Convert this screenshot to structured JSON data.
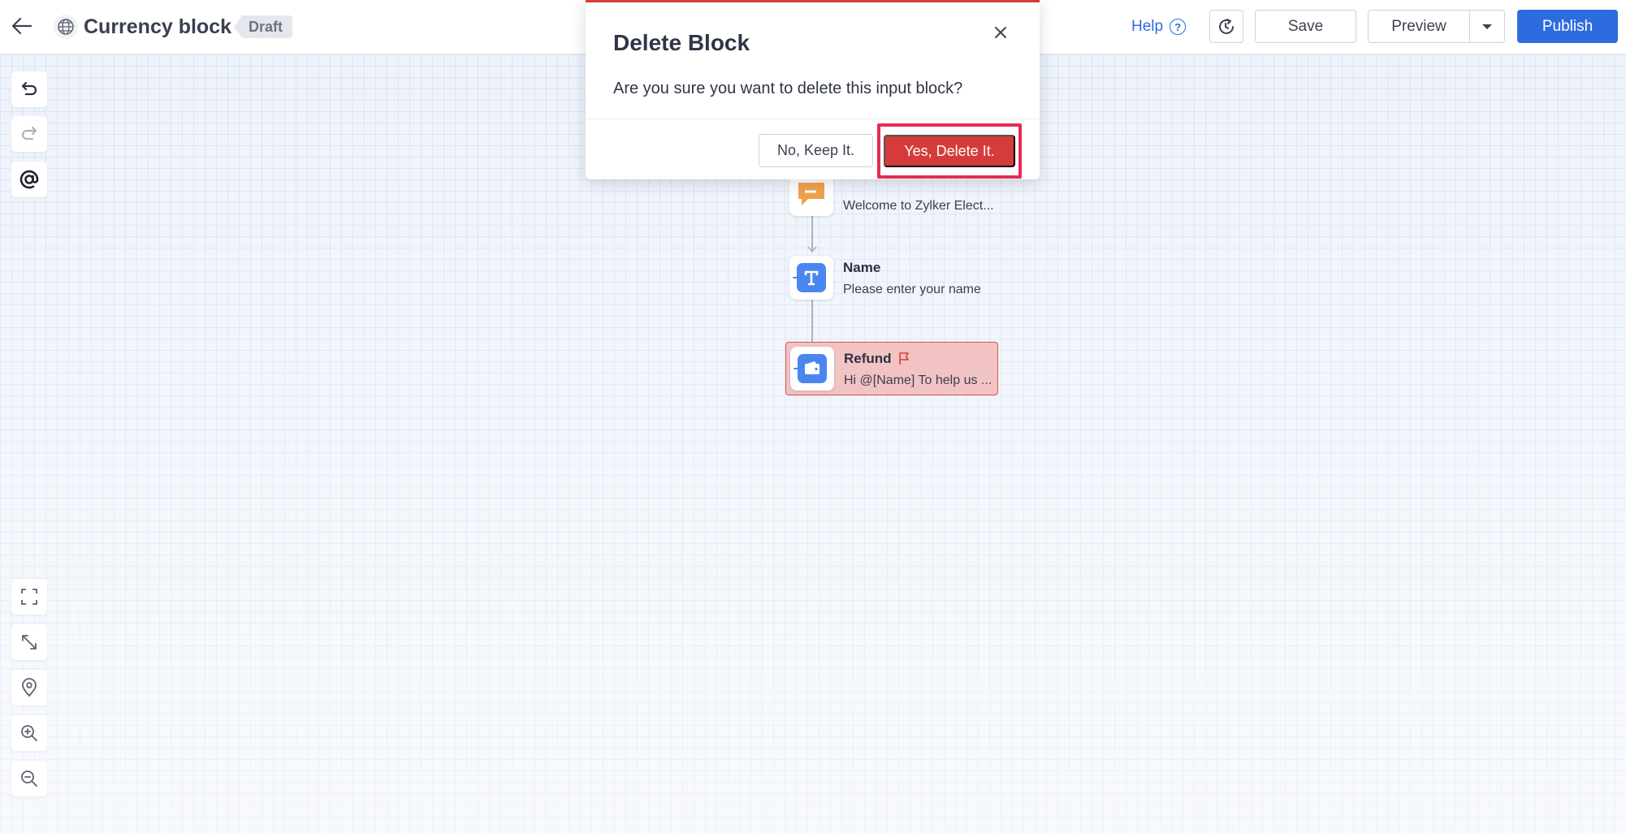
{
  "header": {
    "title": "Currency block",
    "status_badge": "Draft",
    "help_label": "Help",
    "help_symbol": "?",
    "save_label": "Save",
    "preview_label": "Preview",
    "publish_label": "Publish"
  },
  "toolbar_icons": [
    "undo-icon",
    "redo-icon",
    "mention-icon"
  ],
  "view_controls": [
    "fullscreen-icon",
    "fit-to-screen-icon",
    "locate-icon",
    "zoom-in-icon",
    "zoom-out-icon"
  ],
  "flow": {
    "nodes": [
      {
        "title": "",
        "subtitle": "Welcome to Zylker Elect...",
        "icon": "message-icon",
        "state": "normal"
      },
      {
        "title": "Name",
        "subtitle": "Please enter your name",
        "icon": "text-input-icon",
        "state": "normal"
      },
      {
        "title": "Refund",
        "subtitle": "Hi  @[Name]  To help us ...",
        "icon": "wallet-icon",
        "state": "error"
      }
    ]
  },
  "dialog": {
    "title": "Delete Block",
    "message": "Are you sure you want to delete this input block?",
    "keep_label": "No, Keep It.",
    "delete_label": "Yes, Delete It."
  },
  "colors": {
    "primary": "#2d6cdf",
    "danger": "#d63b3b",
    "highlight": "#e52b55",
    "error_bg": "#f2c3c3",
    "canvas_bg": "#eef3fb",
    "node_icon": "#4a86f0",
    "message_icon": "#f0a14a"
  }
}
